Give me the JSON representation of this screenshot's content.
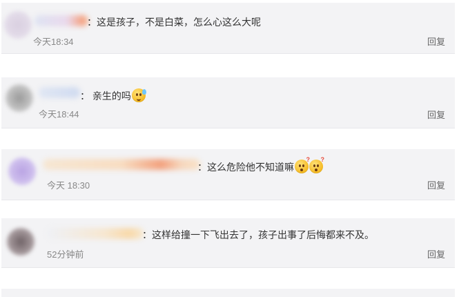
{
  "comments": [
    {
      "text": "：这是孩子，不是白菜，怎么心这么大呢",
      "time": "今天18:34",
      "reply_label": "回复",
      "emojis": []
    },
    {
      "text": "： 亲生的吗",
      "time": "今天18:44",
      "reply_label": "回复",
      "emojis": [
        "sleepy-face"
      ]
    },
    {
      "text": "：这么危险他不知道嘛",
      "time": "今天 18:30",
      "reply_label": "回复",
      "emojis": [
        "wondering-face",
        "wondering-face"
      ]
    },
    {
      "text": "：这样给撞一下飞出去了，孩子出事了后悔都来不及。",
      "time": "52分钟前",
      "reply_label": "回复",
      "emojis": []
    }
  ],
  "colors": {
    "card_bg": "#f3f3f5",
    "text": "#333333",
    "time": "#888888",
    "reply": "#666666"
  }
}
